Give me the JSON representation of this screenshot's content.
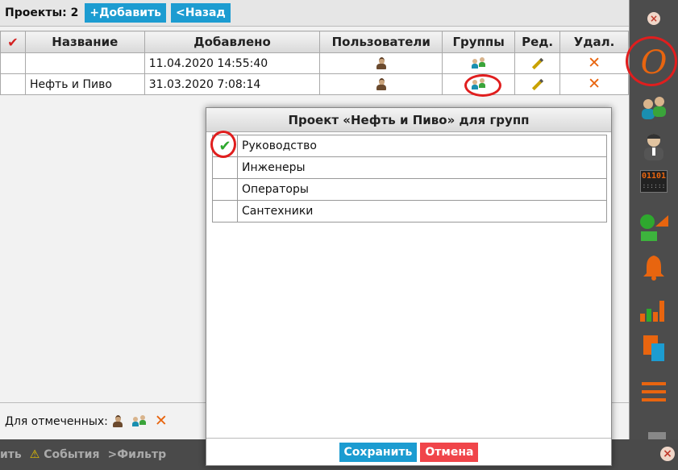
{
  "toolbar": {
    "count_label": "Проекты: 2",
    "add_label": "+Добавить",
    "back_label": "<Назад"
  },
  "table": {
    "headers": {
      "check": "✔",
      "name": "Название",
      "added": "Добавлено",
      "users": "Пользователи",
      "groups": "Группы",
      "edit": "Ред.",
      "delete": "Удал."
    },
    "rows": [
      {
        "name": "",
        "added": "11.04.2020 14:55:40"
      },
      {
        "name": "Нефть и Пиво",
        "added": "31.03.2020 7:08:14"
      }
    ]
  },
  "footer": {
    "for_marked_label": "Для отмеченных:"
  },
  "modal": {
    "title": "Проект «Нефть и Пиво» для групп",
    "groups": [
      {
        "name": "Руководство",
        "checked": "✔"
      },
      {
        "name": "Инженеры",
        "checked": ""
      },
      {
        "name": "Операторы",
        "checked": ""
      },
      {
        "name": "Сантехники",
        "checked": ""
      }
    ],
    "save_label": "Сохранить",
    "cancel_label": "Отмена"
  },
  "bottombar": {
    "cut_label": "ить",
    "events_icon": "⚠",
    "events_label": "События",
    "filter_label": ">Фильтр",
    "close_icon": "×"
  },
  "sidebar": {
    "close_icon": "×",
    "logo_letter": "O",
    "counter_text": "01101"
  },
  "colors": {
    "accent_blue": "#1c9cd1",
    "cancel_red": "#f0454a",
    "sidebar_bg": "#4c4c4c",
    "orange": "#e8650f",
    "check_green": "#2ea82e"
  }
}
